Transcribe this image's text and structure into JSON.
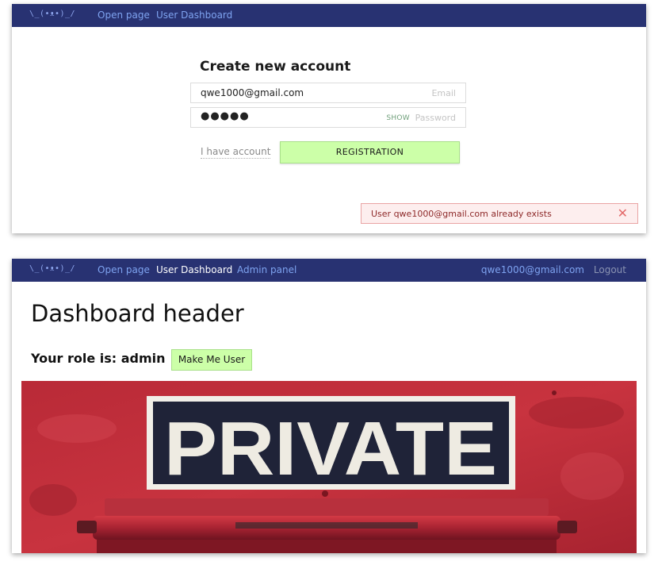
{
  "top_screen": {
    "navbar": {
      "logo": "\\_(•ᴥ•)_/",
      "links": [
        "Open page",
        "User Dashboard"
      ]
    },
    "form": {
      "title": "Create new account",
      "email_value": "qwe1000@gmail.com",
      "email_label": "Email",
      "password_value": "●●●●●",
      "password_label": "Password",
      "show_label": "SHOW",
      "have_account": "I have account",
      "register_button": "REGISTRATION"
    },
    "alert": {
      "message": "User qwe1000@gmail.com already exists",
      "close": "✕"
    }
  },
  "bottom_screen": {
    "navbar": {
      "logo": "\\_(•ᴥ•)_/",
      "links": [
        "Open page",
        "User Dashboard",
        "Admin panel"
      ],
      "user_email": "qwe1000@gmail.com",
      "logout": "Logout"
    },
    "dashboard": {
      "header": "Dashboard header",
      "role_text": "Your role is: admin",
      "make_user_button": "Make Me User",
      "image_sign_text": "PRIVATE"
    }
  },
  "colors": {
    "navbar_bg": "#283272",
    "nav_link": "#7ea3f0",
    "button_green": "#ccffa8",
    "alert_bg": "#fdeeee",
    "door_red": "#c1303d"
  }
}
